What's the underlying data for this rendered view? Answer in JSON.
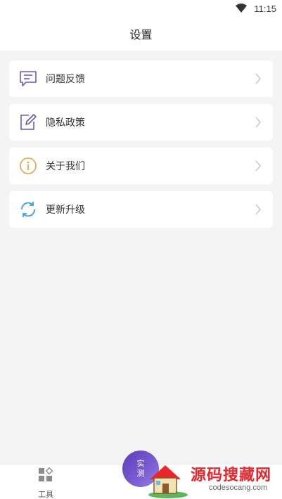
{
  "status_bar": {
    "time": "11:15",
    "wifi_icon": "wifi-icon"
  },
  "header": {
    "title": "设置"
  },
  "menu": {
    "items": [
      {
        "label": "问题反馈",
        "icon": "feedback-icon",
        "color": "#6b5bb5"
      },
      {
        "label": "隐私政策",
        "icon": "edit-icon",
        "color": "#6b5bb5"
      },
      {
        "label": "关于我们",
        "icon": "info-icon",
        "color": "#e3a24a"
      },
      {
        "label": "更新升级",
        "icon": "refresh-icon",
        "color": "#3aa0e0"
      }
    ]
  },
  "bottom_bar": {
    "tools_label": "工具",
    "fab_line1": "实",
    "fab_line2": "测"
  },
  "watermark": {
    "title": "源码搜藏网",
    "url": "codesocang.com"
  }
}
